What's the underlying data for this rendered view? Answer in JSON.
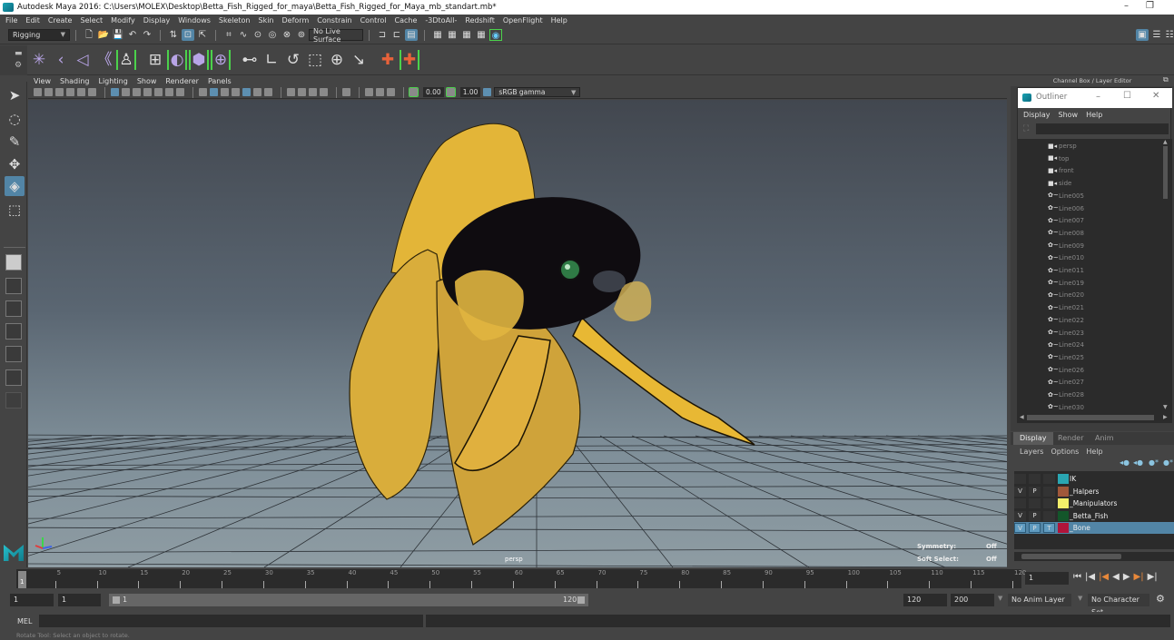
{
  "window": {
    "title": "Autodesk Maya 2016: C:\\Users\\MOLEX\\Desktop\\Betta_Fish_Rigged_for_maya\\Betta_Fish_Rigged_for_Maya_mb_standart.mb*",
    "minimize_glyph": "–",
    "restore_glyph": "❐"
  },
  "menubar": [
    "File",
    "Edit",
    "Create",
    "Select",
    "Modify",
    "Display",
    "Windows",
    "Skeleton",
    "Skin",
    "Deform",
    "Constrain",
    "Control",
    "Cache",
    "-3DtoAll-",
    "Redshift",
    "OpenFlight",
    "Help"
  ],
  "statusline": {
    "menuset": "Rigging",
    "live_surface": "No Live Surface"
  },
  "shelf": {
    "icons": [
      "joint-tool-icon",
      "ik-handle-icon",
      "ik-spline-icon",
      "insert-joint-icon",
      "humanik-icon",
      "bind-skin-icon",
      "smooth-bind-icon",
      "lattice-icon",
      "cluster-icon",
      "parent-constraint-icon",
      "point-constraint-icon",
      "orient-constraint-icon",
      "scale-constraint-icon",
      "aim-constraint-icon",
      "pole-vector-icon",
      "locator-icon",
      "locator-bracket-icon"
    ]
  },
  "toolbox": {
    "tools": [
      {
        "name": "select-tool",
        "glyph": "➤",
        "active": false
      },
      {
        "name": "lasso-tool",
        "glyph": "◌",
        "active": false
      },
      {
        "name": "paint-select-tool",
        "glyph": "✎",
        "active": false
      },
      {
        "name": "move-tool",
        "glyph": "✥",
        "active": false
      },
      {
        "name": "rotate-tool",
        "glyph": "◈",
        "active": true
      },
      {
        "name": "scale-tool",
        "glyph": "⬚",
        "active": false
      }
    ]
  },
  "viewport": {
    "menus": [
      "View",
      "Shading",
      "Lighting",
      "Show",
      "Renderer",
      "Panels"
    ],
    "exposure": "0.00",
    "gamma": "1.00",
    "color_space": "sRGB gamma",
    "camera_label": "persp",
    "hud": [
      {
        "label": "Symmetry:",
        "value": "Off"
      },
      {
        "label": "Soft Select:",
        "value": "Off"
      }
    ]
  },
  "rightpanel": {
    "header": "Channel Box / Layer Editor",
    "outliner": {
      "title": "Outliner",
      "menus": [
        "Display",
        "Show",
        "Help"
      ],
      "filter_placeholder": "",
      "items": [
        {
          "label": "persp",
          "type": "camera"
        },
        {
          "label": "top",
          "type": "camera"
        },
        {
          "label": "front",
          "type": "camera"
        },
        {
          "label": "side",
          "type": "camera"
        },
        {
          "label": "Line005",
          "type": "curve"
        },
        {
          "label": "Line006",
          "type": "curve"
        },
        {
          "label": "Line007",
          "type": "curve"
        },
        {
          "label": "Line008",
          "type": "curve"
        },
        {
          "label": "Line009",
          "type": "curve"
        },
        {
          "label": "Line010",
          "type": "curve"
        },
        {
          "label": "Line011",
          "type": "curve"
        },
        {
          "label": "Line019",
          "type": "curve"
        },
        {
          "label": "Line020",
          "type": "curve"
        },
        {
          "label": "Line021",
          "type": "curve"
        },
        {
          "label": "Line022",
          "type": "curve"
        },
        {
          "label": "Line023",
          "type": "curve"
        },
        {
          "label": "Line024",
          "type": "curve"
        },
        {
          "label": "Line025",
          "type": "curve"
        },
        {
          "label": "Line026",
          "type": "curve"
        },
        {
          "label": "Line027",
          "type": "curve"
        },
        {
          "label": "Line028",
          "type": "curve"
        },
        {
          "label": "Line030",
          "type": "curve"
        }
      ]
    },
    "layer_tabs": [
      "Display",
      "Render",
      "Anim"
    ],
    "layer_menus": [
      "Layers",
      "Options",
      "Help"
    ],
    "layers": [
      {
        "v": "",
        "p": "",
        "t": "",
        "color": "#2aa6b2",
        "name": "IK",
        "selected": false
      },
      {
        "v": "V",
        "p": "P",
        "t": "",
        "color": "#a0583a",
        "name": "_Halpers",
        "selected": false
      },
      {
        "v": "",
        "p": "",
        "t": "",
        "color": "#f2ee6a",
        "name": "_Manipulators",
        "selected": false
      },
      {
        "v": "V",
        "p": "P",
        "t": "",
        "color": "#13562a",
        "name": "_Betta_Fish",
        "selected": false
      },
      {
        "v": "V",
        "p": "P",
        "t": "T",
        "color": "#b0143a",
        "name": "_Bone",
        "selected": true
      }
    ]
  },
  "timeline": {
    "ticks": [
      "5",
      "10",
      "15",
      "20",
      "25",
      "30",
      "35",
      "40",
      "45",
      "50",
      "55",
      "60",
      "65",
      "70",
      "75",
      "80",
      "85",
      "90",
      "95",
      "100",
      "105",
      "110",
      "115",
      "120"
    ],
    "current_frame": "1",
    "current_frame_field": "1"
  },
  "range": {
    "start": "1",
    "playback_start": "1",
    "slider_start": "1",
    "slider_end": "120",
    "playback_end": "120",
    "end": "200",
    "anim_layer": "No Anim Layer",
    "character_set": "No Character Set"
  },
  "commandline": {
    "label": "MEL",
    "value": ""
  },
  "helpline": "Rotate Tool: Select an object to rotate."
}
